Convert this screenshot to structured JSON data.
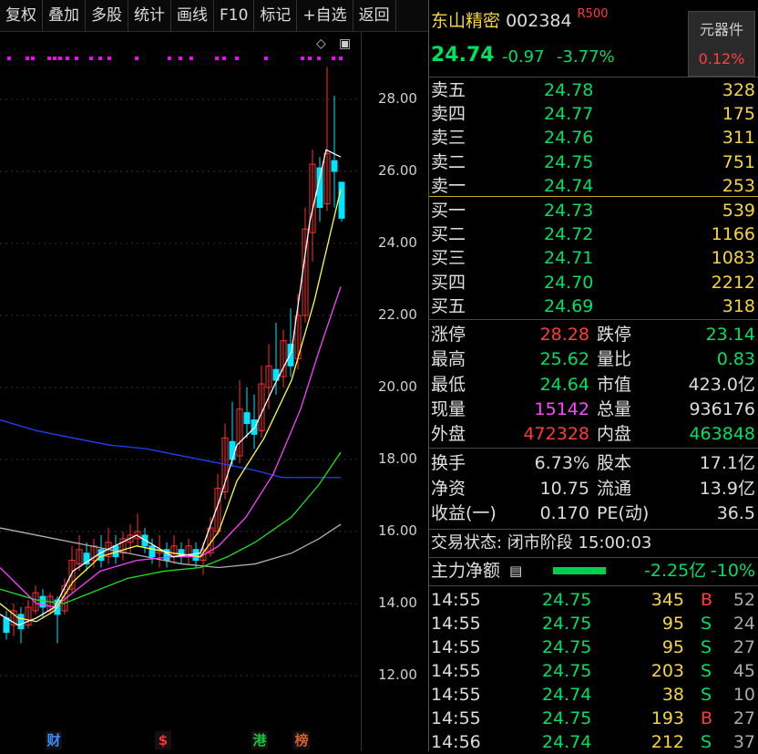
{
  "toolbar": [
    "复权",
    "叠加",
    "多股",
    "统计",
    "画线",
    "F10",
    "标记",
    "+自选",
    "返回"
  ],
  "y_axis_labels": [
    "28.00",
    "26.00",
    "24.00",
    "22.00",
    "20.00",
    "18.00",
    "16.00",
    "14.00",
    "12.00"
  ],
  "chart_controls": {
    "diamond": "◇",
    "square": "▣"
  },
  "events": [
    {
      "label": "财",
      "color": "#3b8bff"
    },
    {
      "label": "$",
      "color": "#ff3030"
    },
    {
      "label": "港",
      "color": "#20c040"
    },
    {
      "label": "榜",
      "color": "#d06030"
    }
  ],
  "stock": {
    "name": "东山精密",
    "code": "002384",
    "tag": "R500",
    "price": "24.74",
    "change": "-0.97",
    "change_pct": "-3.77%"
  },
  "sector": {
    "name": "元器件",
    "pct": "0.12%"
  },
  "sell_orders": [
    {
      "label": "卖五",
      "price": "24.78",
      "vol": "328"
    },
    {
      "label": "卖四",
      "price": "24.77",
      "vol": "175"
    },
    {
      "label": "卖三",
      "price": "24.76",
      "vol": "311"
    },
    {
      "label": "卖二",
      "price": "24.75",
      "vol": "751"
    },
    {
      "label": "卖一",
      "price": "24.74",
      "vol": "253"
    }
  ],
  "buy_orders": [
    {
      "label": "买一",
      "price": "24.73",
      "vol": "539"
    },
    {
      "label": "买二",
      "price": "24.72",
      "vol": "1166"
    },
    {
      "label": "买三",
      "price": "24.71",
      "vol": "1083"
    },
    {
      "label": "买四",
      "price": "24.70",
      "vol": "2212"
    },
    {
      "label": "买五",
      "price": "24.69",
      "vol": "318"
    }
  ],
  "stats_a": [
    {
      "l1": "涨停",
      "v1": "28.28",
      "c1": "rd",
      "l2": "跌停",
      "v2": "23.14",
      "c2": "g"
    },
    {
      "l1": "最高",
      "v1": "25.62",
      "c1": "g",
      "l2": "量比",
      "v2": "0.83",
      "c2": "g"
    },
    {
      "l1": "最低",
      "v1": "24.64",
      "c1": "g",
      "l2": "市值",
      "v2": "423.0亿",
      "c2": "w"
    },
    {
      "l1": "现量",
      "v1": "15142",
      "c1": "p",
      "l2": "总量",
      "v2": "936176",
      "c2": "w"
    },
    {
      "l1": "外盘",
      "v1": "472328",
      "c1": "rd",
      "l2": "内盘",
      "v2": "463848",
      "c2": "g"
    }
  ],
  "stats_b": [
    {
      "l1": "换手",
      "v1": "6.73%",
      "l2": "股本",
      "v2": "17.1亿"
    },
    {
      "l1": "净资",
      "v1": "10.75",
      "l2": "流通",
      "v2": "13.9亿"
    },
    {
      "l1": "收益(一)",
      "v1": "0.170",
      "l2": "PE(动)",
      "v2": "36.5"
    }
  ],
  "trade_status": "交易状态: 闭市阶段 15:00:03",
  "main_flow": {
    "label": "主力净额",
    "value": "-2.25亿",
    "pct": "-10%"
  },
  "ticks": [
    {
      "time": "14:55",
      "price": "24.75",
      "vol": "345",
      "side": "B",
      "n": "52"
    },
    {
      "time": "14:55",
      "price": "24.75",
      "vol": "95",
      "side": "S",
      "n": "24"
    },
    {
      "time": "14:55",
      "price": "24.75",
      "vol": "95",
      "side": "S",
      "n": "27"
    },
    {
      "time": "14:55",
      "price": "24.75",
      "vol": "203",
      "side": "S",
      "n": "45"
    },
    {
      "time": "14:55",
      "price": "24.74",
      "vol": "38",
      "side": "S",
      "n": "10"
    },
    {
      "time": "14:55",
      "price": "24.75",
      "vol": "193",
      "side": "B",
      "n": "27"
    },
    {
      "time": "14:56",
      "price": "24.74",
      "vol": "212",
      "side": "S",
      "n": "37"
    }
  ]
}
